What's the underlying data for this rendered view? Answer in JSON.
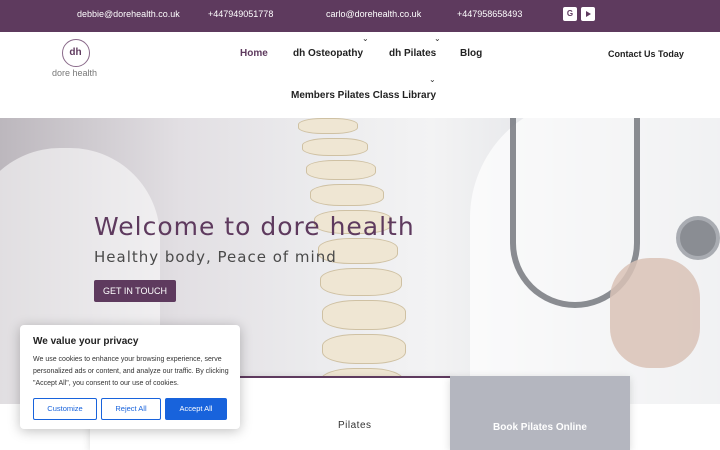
{
  "topbar": {
    "email_1": "debbie@dorehealth.co.uk",
    "phone_1": "+447949051778",
    "email_2": "carlo@dorehealth.co.uk",
    "phone_2": "+447958658493",
    "social_google_glyph": "G",
    "social_icons": [
      "google-icon",
      "youtube-icon"
    ],
    "bg_color": "#5e3a5e"
  },
  "header": {
    "logo_monogram": "dh",
    "logo_text": "dore health",
    "nav": {
      "home": "Home",
      "osteopathy": "dh Osteopathy",
      "pilates": "dh Pilates",
      "blog": "Blog",
      "members": "Members Pilates Class Library"
    },
    "chevron_glyph": "⌄",
    "contact": "Contact Us Today"
  },
  "hero": {
    "title": "Welcome to dore health",
    "subtitle": "Healthy body, Peace of mind",
    "cta": "GET IN TOUCH"
  },
  "cards": {
    "pilates": "Pilates",
    "book": "Book Pilates Online"
  },
  "cookie": {
    "title": "We value your privacy",
    "text": "We use cookies to enhance your browsing experience, serve personalized ads or content, and analyze our traffic. By clicking \"Accept All\", you consent to our use of cookies.",
    "customize": "Customize",
    "reject": "Reject All",
    "accept": "Accept All",
    "accent_color": "#1863dc"
  }
}
